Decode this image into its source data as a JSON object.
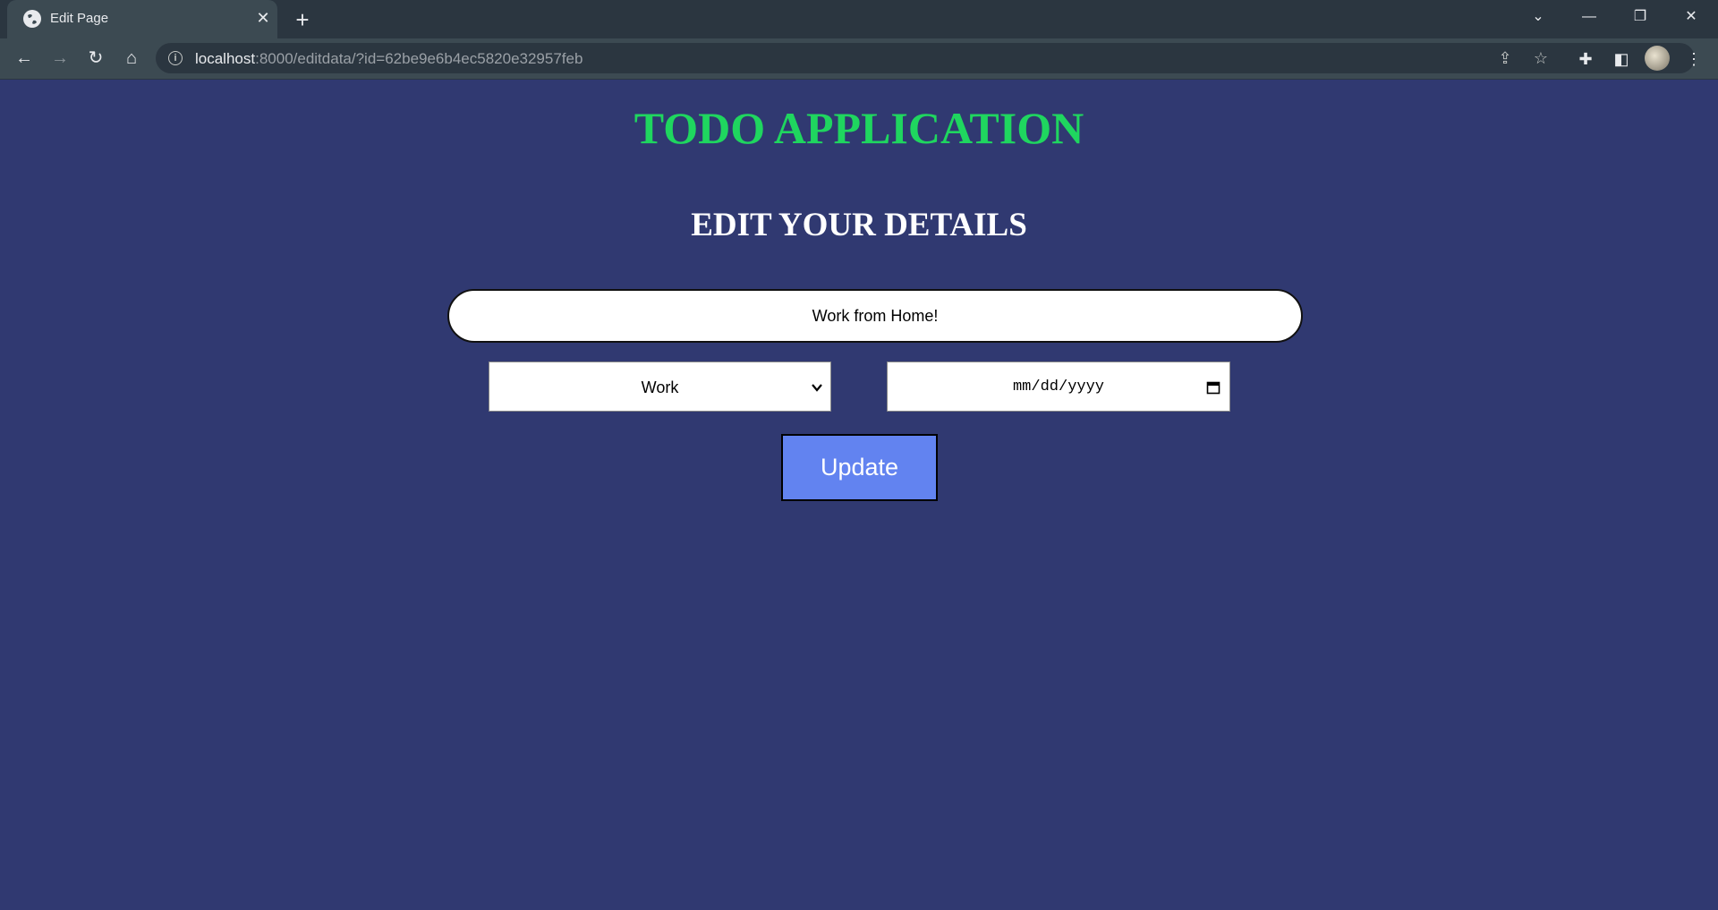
{
  "browser": {
    "tab_title": "Edit Page",
    "new_tab_icon": "plus-icon",
    "address": {
      "host": "localhost",
      "path": ":8000/editdata/?id=62be9e6b4ec5820e32957feb"
    },
    "icons": [
      "back-icon",
      "forward-icon",
      "reload-icon",
      "home-icon",
      "info-icon",
      "share-icon",
      "star-icon",
      "extensions-icon",
      "sidebar-icon",
      "avatar",
      "menu-icon"
    ]
  },
  "page": {
    "app_title": "TODO APPLICATION",
    "form_title": "EDIT YOUR DETAILS",
    "task_value": "Work from Home!",
    "category_selected": "Work",
    "date_placeholder": "mm/dd/yyyy",
    "update_label": "Update"
  },
  "colors": {
    "page_background": "#303971",
    "title_color": "#1fd65f",
    "button_color": "#6283f0"
  }
}
